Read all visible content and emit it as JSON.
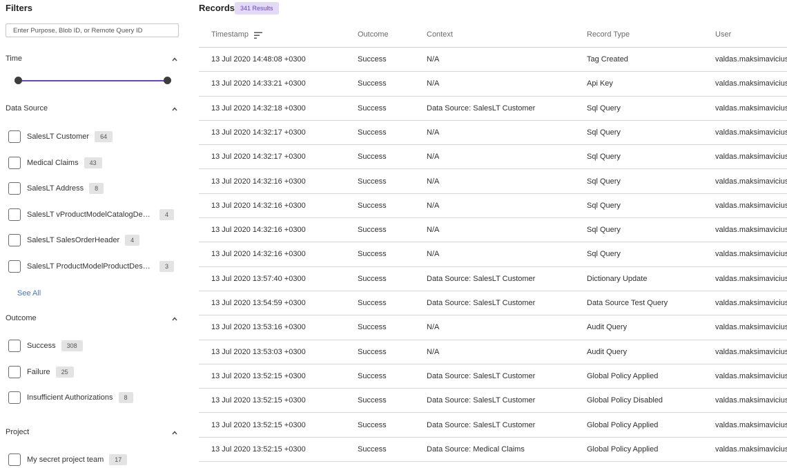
{
  "sidebar": {
    "title": "Filters",
    "search_placeholder": "Enter Purpose, Blob ID, or Remote Query ID",
    "time": {
      "title": "Time"
    },
    "data_source": {
      "title": "Data Source",
      "items": [
        {
          "label": "SalesLT Customer",
          "count": "64"
        },
        {
          "label": "Medical Claims",
          "count": "43"
        },
        {
          "label": "SalesLT Address",
          "count": "8"
        },
        {
          "label": "SalesLT vProductModelCatalogDescription",
          "count": "4"
        },
        {
          "label": "SalesLT SalesOrderHeader",
          "count": "4"
        },
        {
          "label": "SalesLT ProductModelProductDescription",
          "count": "3"
        }
      ],
      "see_all": "See All"
    },
    "outcome": {
      "title": "Outcome",
      "items": [
        {
          "label": "Success",
          "count": "308"
        },
        {
          "label": "Failure",
          "count": "25"
        },
        {
          "label": "Insufficient Authorizations",
          "count": "8"
        }
      ]
    },
    "project": {
      "title": "Project",
      "items": [
        {
          "label": "My secret project team",
          "count": "17"
        }
      ]
    }
  },
  "main": {
    "title": "Records",
    "results_badge": "341 Results",
    "columns": [
      "Timestamp",
      "Outcome",
      "Context",
      "Record Type",
      "User"
    ],
    "rows": [
      [
        "13 Jul 2020 14:48:08 +0300",
        "Success",
        "N/A",
        "Tag Created",
        "valdas.maksimavicius"
      ],
      [
        "13 Jul 2020 14:33:21 +0300",
        "Success",
        "N/A",
        "Api Key",
        "valdas.maksimavicius"
      ],
      [
        "13 Jul 2020 14:32:18 +0300",
        "Success",
        "Data Source: SalesLT Customer",
        "Sql Query",
        "valdas.maksimavicius"
      ],
      [
        "13 Jul 2020 14:32:17 +0300",
        "Success",
        "N/A",
        "Sql Query",
        "valdas.maksimavicius"
      ],
      [
        "13 Jul 2020 14:32:17 +0300",
        "Success",
        "N/A",
        "Sql Query",
        "valdas.maksimavicius"
      ],
      [
        "13 Jul 2020 14:32:16 +0300",
        "Success",
        "N/A",
        "Sql Query",
        "valdas.maksimavicius"
      ],
      [
        "13 Jul 2020 14:32:16 +0300",
        "Success",
        "N/A",
        "Sql Query",
        "valdas.maksimavicius"
      ],
      [
        "13 Jul 2020 14:32:16 +0300",
        "Success",
        "N/A",
        "Sql Query",
        "valdas.maksimavicius"
      ],
      [
        "13 Jul 2020 14:32:16 +0300",
        "Success",
        "N/A",
        "Sql Query",
        "valdas.maksimavicius"
      ],
      [
        "13 Jul 2020 13:57:40 +0300",
        "Success",
        "Data Source: SalesLT Customer",
        "Dictionary Update",
        "valdas.maksimavicius"
      ],
      [
        "13 Jul 2020 13:54:59 +0300",
        "Success",
        "Data Source: SalesLT Customer",
        "Data Source Test Query",
        "valdas.maksimavicius"
      ],
      [
        "13 Jul 2020 13:53:16 +0300",
        "Success",
        "N/A",
        "Audit Query",
        "valdas.maksimavicius"
      ],
      [
        "13 Jul 2020 13:53:03 +0300",
        "Success",
        "N/A",
        "Audit Query",
        "valdas.maksimavicius"
      ],
      [
        "13 Jul 2020 13:52:15 +0300",
        "Success",
        "Data Source: SalesLT Customer",
        "Global Policy Applied",
        "valdas.maksimavicius"
      ],
      [
        "13 Jul 2020 13:52:15 +0300",
        "Success",
        "Data Source: SalesLT Customer",
        "Global Policy Disabled",
        "valdas.maksimavicius"
      ],
      [
        "13 Jul 2020 13:52:15 +0300",
        "Success",
        "Data Source: SalesLT Customer",
        "Global Policy Applied",
        "valdas.maksimavicius"
      ],
      [
        "13 Jul 2020 13:52:15 +0300",
        "Success",
        "Data Source: Medical Claims",
        "Global Policy Applied",
        "valdas.maksimavicius"
      ]
    ]
  },
  "colors": {
    "accent": "#6a3fd1",
    "badge_bg": "#e3dbf6",
    "link": "#4b73c9"
  }
}
